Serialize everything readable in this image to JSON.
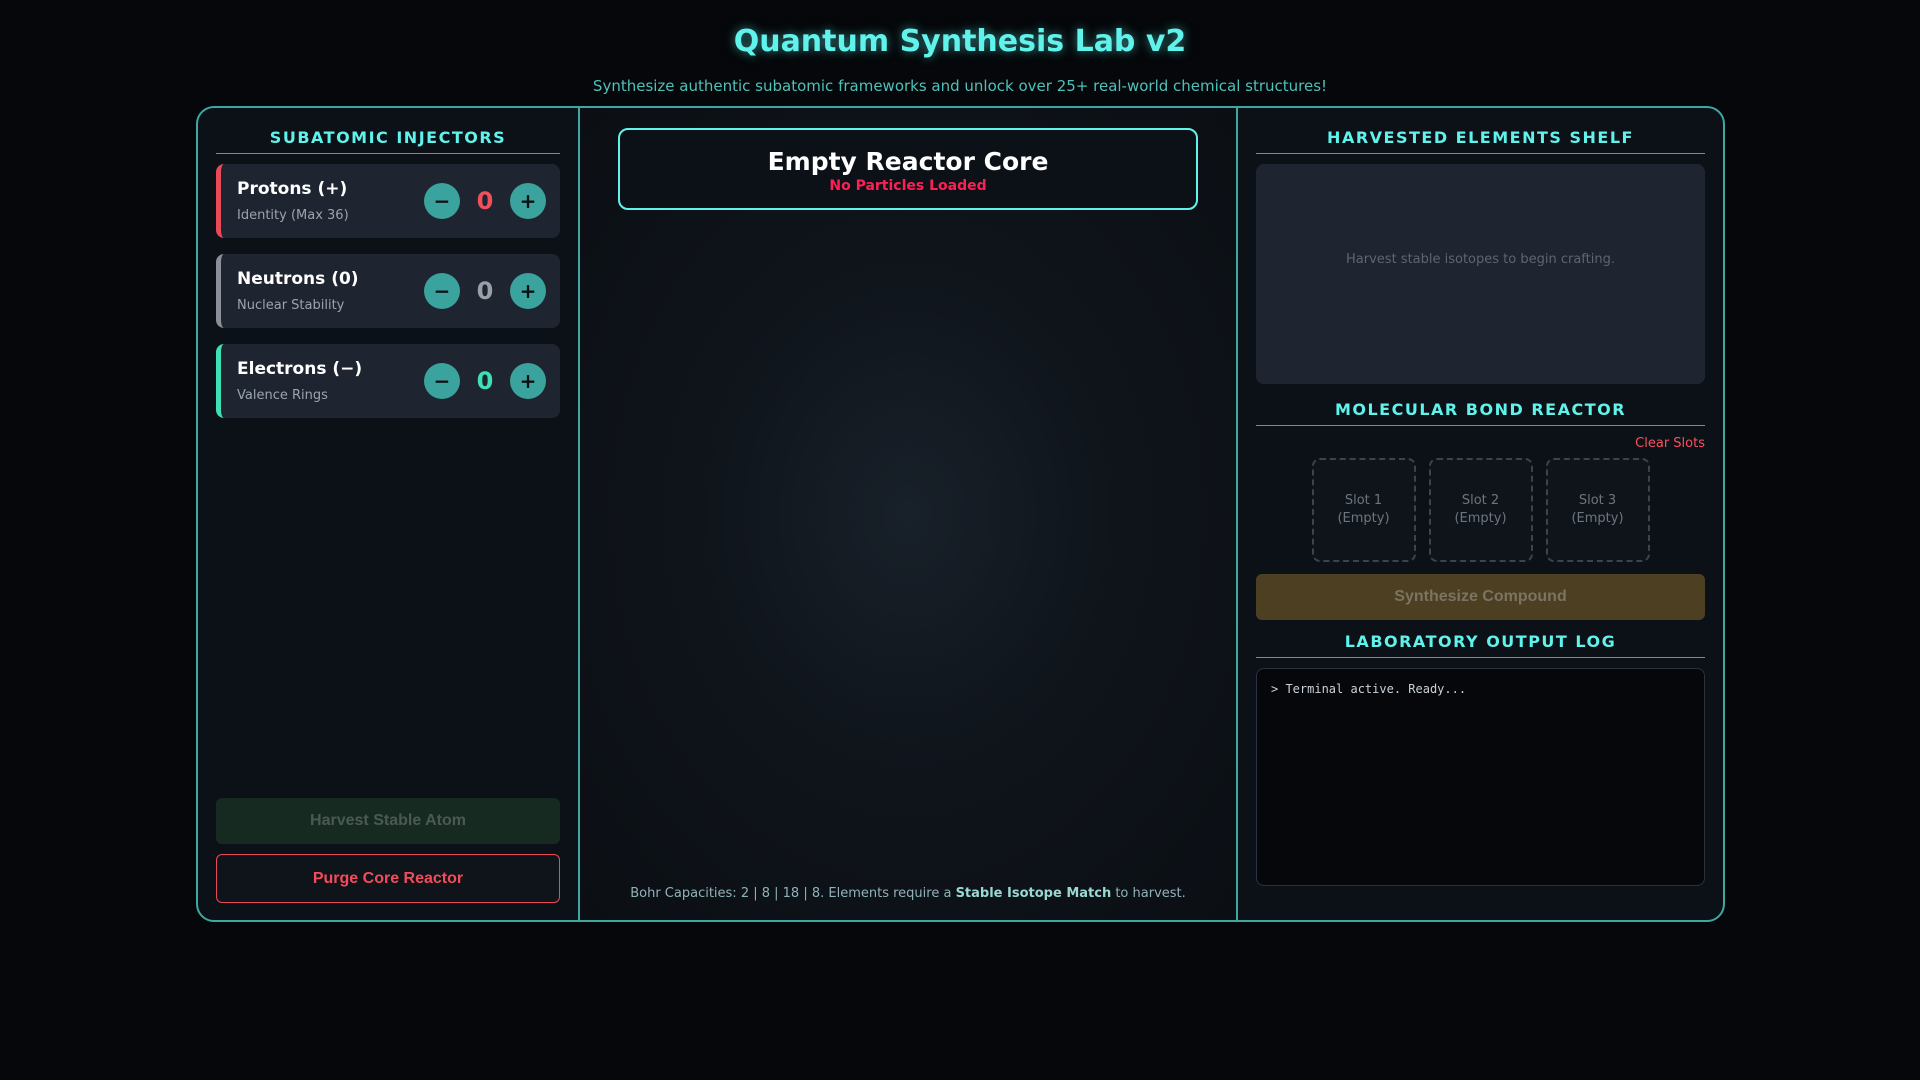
{
  "header": {
    "title": "Quantum Synthesis Lab v2",
    "subtitle": "Synthesize authentic subatomic frameworks and unlock over 25+ real-world chemical structures!"
  },
  "left": {
    "section_title": "SUBATOMIC INJECTORS",
    "injectors": [
      {
        "name": "Protons (+)",
        "desc": "Identity (Max 36)",
        "value": "0",
        "minus": "−",
        "plus": "+"
      },
      {
        "name": "Neutrons (0)",
        "desc": "Nuclear Stability",
        "value": "0",
        "minus": "−",
        "plus": "+"
      },
      {
        "name": "Electrons (−)",
        "desc": "Valence Rings",
        "value": "0",
        "minus": "−",
        "plus": "+"
      }
    ],
    "harvest_label": "Harvest Stable Atom",
    "purge_label": "Purge Core Reactor"
  },
  "center": {
    "core_title": "Empty Reactor Core",
    "core_status": "No Particles Loaded",
    "note_prefix": "Bohr Capacities: 2 | 8 | 18 | 8. Elements require a ",
    "note_bold": "Stable Isotope Match",
    "note_suffix": " to harvest."
  },
  "right": {
    "shelf_title": "HARVESTED ELEMENTS SHELF",
    "shelf_placeholder": "Harvest stable isotopes to begin crafting.",
    "bond_title": "MOLECULAR BOND REACTOR",
    "clear_label": "Clear Slots",
    "slots": [
      {
        "label": "Slot 1",
        "state": "(Empty)"
      },
      {
        "label": "Slot 2",
        "state": "(Empty)"
      },
      {
        "label": "Slot 3",
        "state": "(Empty)"
      }
    ],
    "synth_label": "Synthesize Compound",
    "log_title": "LABORATORY OUTPUT LOG",
    "log_lines": [
      "> Terminal active. Ready..."
    ]
  },
  "colors": {
    "accent": "#5ff3ec",
    "proton": "#e94a57",
    "neutron": "#8b9098",
    "electron": "#3fe0b4",
    "danger": "#ff1f55"
  }
}
